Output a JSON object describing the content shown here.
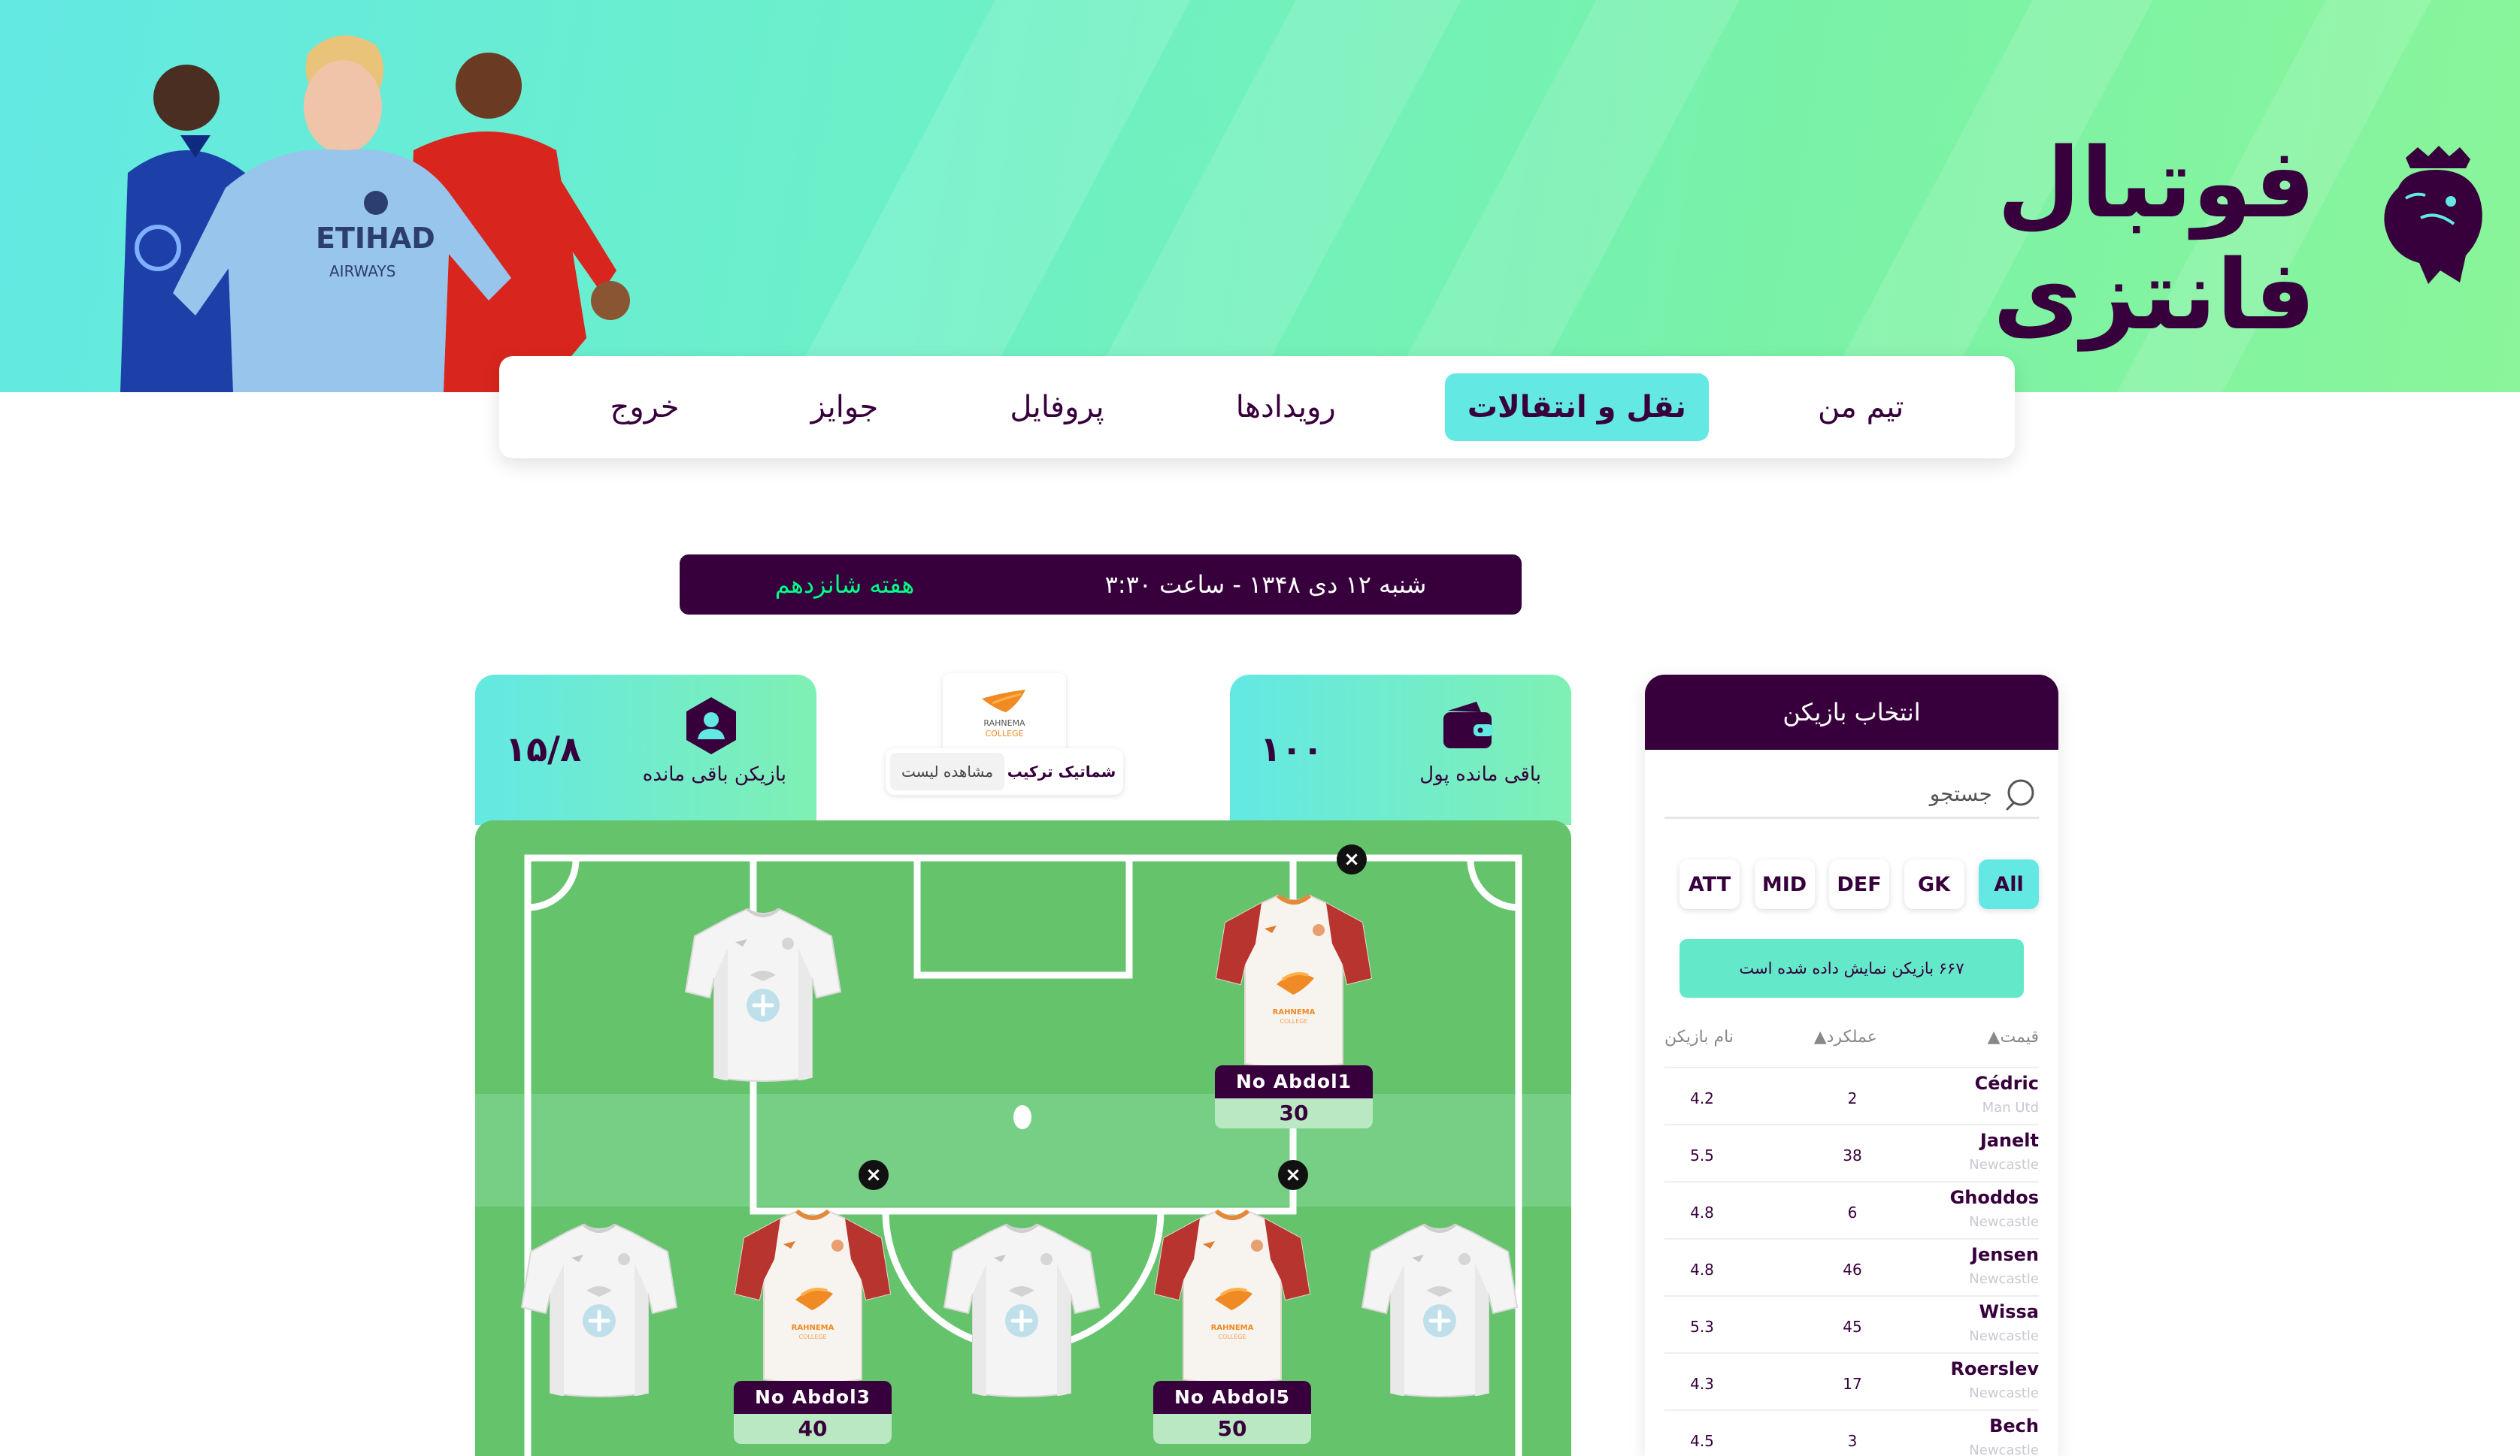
{
  "header": {
    "title": "فوتبال فانتزی",
    "logo_icon": "premier-league-lion-icon"
  },
  "nav": {
    "items": [
      {
        "label": "تیم من",
        "active": false
      },
      {
        "label": "نقل و انتقالات",
        "active": true
      },
      {
        "label": "رویدادها",
        "active": false
      },
      {
        "label": "پروفایل",
        "active": false
      },
      {
        "label": "جوایز",
        "active": false
      },
      {
        "label": "خروج",
        "active": false
      }
    ]
  },
  "gameweek": {
    "week": "هفته شانزدهم",
    "datetime": "شنبه ۱۲ دی ۱۳۴۸ - ساعت ۳:۳۰"
  },
  "budget": {
    "value": "۱۰۰",
    "label": "باقی مانده پول",
    "icon": "wallet-icon"
  },
  "players_left": {
    "value": "۱۵/۸",
    "label": "بازیکن باقی مانده",
    "icon": "user-icon"
  },
  "center": {
    "logo_text_1": "RAHNEMA",
    "logo_text_2": "COLLEGE",
    "toggle_pitch": "شماتیک ترکیب",
    "toggle_list": "مشاهده لیست"
  },
  "pitch": {
    "slots": [
      {
        "name": "No Abdol1",
        "score": "30"
      },
      {
        "name": "No Abdol3",
        "score": "40"
      },
      {
        "name": "No Abdol5",
        "score": "50"
      }
    ]
  },
  "panel": {
    "title": "انتخاب بازیکن",
    "search_placeholder": "جستجو",
    "filters": [
      "All",
      "GK",
      "DEF",
      "MID",
      "ATT"
    ],
    "active_filter": "All",
    "count_text": "۶۶۷ بازیکن نمایش داده شده است",
    "col_name": "نام بازیکن",
    "col_score": "عملکرد▲",
    "col_price": "قیمت▲",
    "rows": [
      {
        "name": "Cédric",
        "club": "Man Utd",
        "score": "2",
        "price": "4.2"
      },
      {
        "name": "Janelt",
        "club": "Newcastle",
        "score": "38",
        "price": "5.5"
      },
      {
        "name": "Ghoddos",
        "club": "Newcastle",
        "score": "6",
        "price": "4.8"
      },
      {
        "name": "Jensen",
        "club": "Newcastle",
        "score": "46",
        "price": "4.8"
      },
      {
        "name": "Wissa",
        "club": "Newcastle",
        "score": "45",
        "price": "5.3"
      },
      {
        "name": "Roerslev",
        "club": "Newcastle",
        "score": "17",
        "price": "4.3"
      },
      {
        "name": "Bech",
        "club": "Newcastle",
        "score": "3",
        "price": "4.5"
      }
    ]
  },
  "colors": {
    "primary": "#37003c",
    "accent": "#63e8e3",
    "green": "#00ff87",
    "pitch": "#65c36c"
  }
}
